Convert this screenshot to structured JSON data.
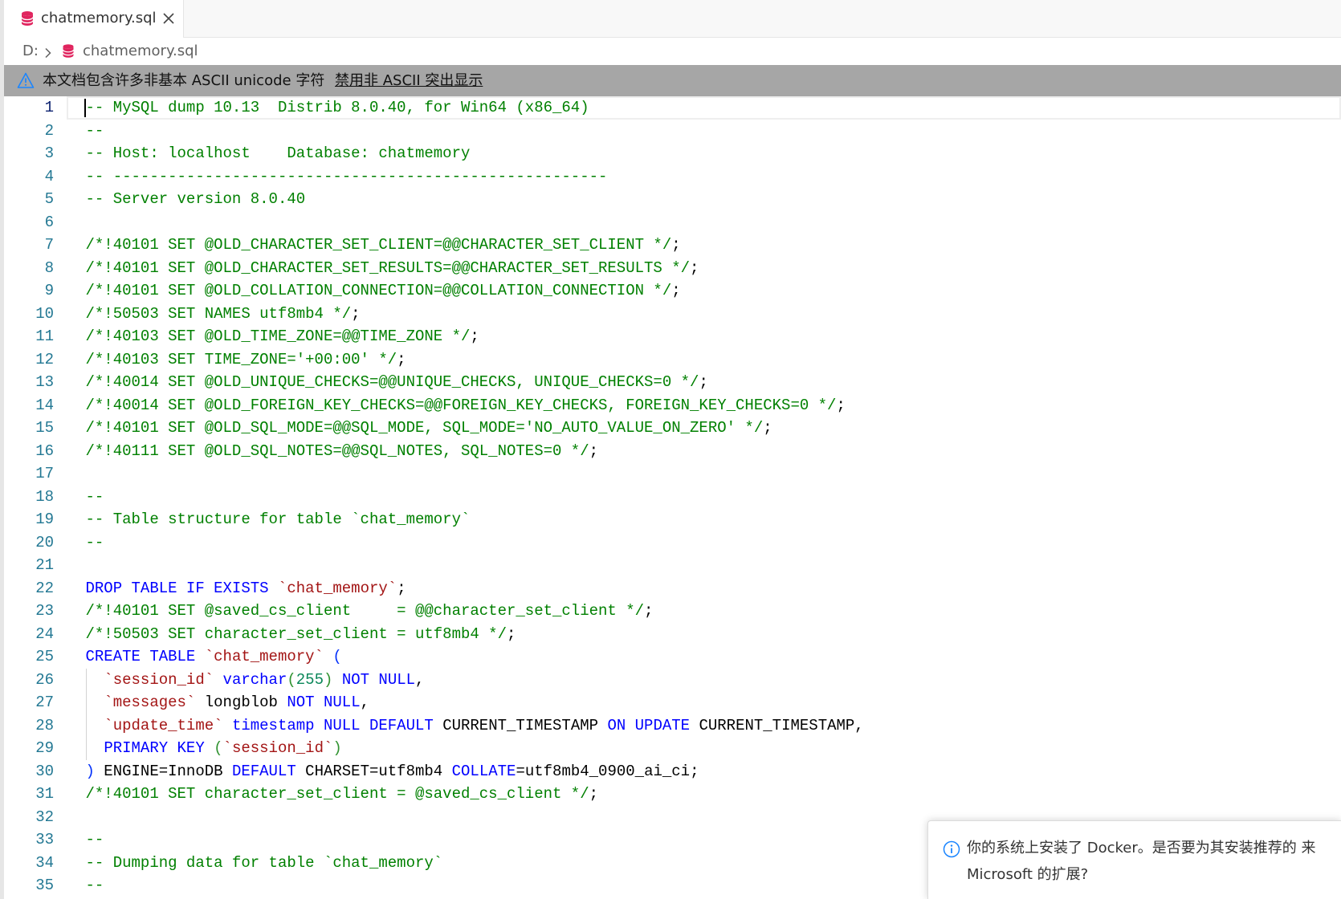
{
  "tab": {
    "title": "chatmemory.sql",
    "icon": "database-icon",
    "close_icon": "close-icon"
  },
  "breadcrumb": {
    "drive": "D:",
    "separator_icon": "chevron-right-icon",
    "file_icon": "database-icon",
    "file": "chatmemory.sql"
  },
  "banner": {
    "icon": "warning-icon",
    "message": "本文档包含许多非基本 ASCII unicode 字符",
    "action": "禁用非 ASCII 突出显示"
  },
  "editor": {
    "active_line": 1,
    "lines": [
      {
        "n": 1,
        "tokens": [
          {
            "t": "c",
            "v": "-- MySQL dump 10.13  Distrib 8.0.40, for Win64 (x86_64)"
          }
        ]
      },
      {
        "n": 2,
        "tokens": [
          {
            "t": "c",
            "v": "--"
          }
        ]
      },
      {
        "n": 3,
        "tokens": [
          {
            "t": "c",
            "v": "-- Host: localhost    Database: chatmemory"
          }
        ]
      },
      {
        "n": 4,
        "tokens": [
          {
            "t": "c",
            "v": "-- ------------------------------------------------------"
          }
        ]
      },
      {
        "n": 5,
        "tokens": [
          {
            "t": "c",
            "v": "-- Server version 8.0.40"
          }
        ]
      },
      {
        "n": 6,
        "tokens": []
      },
      {
        "n": 7,
        "tokens": [
          {
            "t": "c",
            "v": "/*!40101 SET @OLD_CHARACTER_SET_CLIENT=@@CHARACTER_SET_CLIENT */"
          },
          {
            "t": "p",
            "v": ";"
          }
        ]
      },
      {
        "n": 8,
        "tokens": [
          {
            "t": "c",
            "v": "/*!40101 SET @OLD_CHARACTER_SET_RESULTS=@@CHARACTER_SET_RESULTS */"
          },
          {
            "t": "p",
            "v": ";"
          }
        ]
      },
      {
        "n": 9,
        "tokens": [
          {
            "t": "c",
            "v": "/*!40101 SET @OLD_COLLATION_CONNECTION=@@COLLATION_CONNECTION */"
          },
          {
            "t": "p",
            "v": ";"
          }
        ]
      },
      {
        "n": 10,
        "tokens": [
          {
            "t": "c",
            "v": "/*!50503 SET NAMES utf8mb4 */"
          },
          {
            "t": "p",
            "v": ";"
          }
        ]
      },
      {
        "n": 11,
        "tokens": [
          {
            "t": "c",
            "v": "/*!40103 SET @OLD_TIME_ZONE=@@TIME_ZONE */"
          },
          {
            "t": "p",
            "v": ";"
          }
        ]
      },
      {
        "n": 12,
        "tokens": [
          {
            "t": "c",
            "v": "/*!40103 SET TIME_ZONE='+00:00' */"
          },
          {
            "t": "p",
            "v": ";"
          }
        ]
      },
      {
        "n": 13,
        "tokens": [
          {
            "t": "c",
            "v": "/*!40014 SET @OLD_UNIQUE_CHECKS=@@UNIQUE_CHECKS, UNIQUE_CHECKS=0 */"
          },
          {
            "t": "p",
            "v": ";"
          }
        ]
      },
      {
        "n": 14,
        "tokens": [
          {
            "t": "c",
            "v": "/*!40014 SET @OLD_FOREIGN_KEY_CHECKS=@@FOREIGN_KEY_CHECKS, FOREIGN_KEY_CHECKS=0 */"
          },
          {
            "t": "p",
            "v": ";"
          }
        ]
      },
      {
        "n": 15,
        "tokens": [
          {
            "t": "c",
            "v": "/*!40101 SET @OLD_SQL_MODE=@@SQL_MODE, SQL_MODE='NO_AUTO_VALUE_ON_ZERO' */"
          },
          {
            "t": "p",
            "v": ";"
          }
        ]
      },
      {
        "n": 16,
        "tokens": [
          {
            "t": "c",
            "v": "/*!40111 SET @OLD_SQL_NOTES=@@SQL_NOTES, SQL_NOTES=0 */"
          },
          {
            "t": "p",
            "v": ";"
          }
        ]
      },
      {
        "n": 17,
        "tokens": []
      },
      {
        "n": 18,
        "tokens": [
          {
            "t": "c",
            "v": "--"
          }
        ]
      },
      {
        "n": 19,
        "tokens": [
          {
            "t": "c",
            "v": "-- Table structure for table `chat_memory`"
          }
        ]
      },
      {
        "n": 20,
        "tokens": [
          {
            "t": "c",
            "v": "--"
          }
        ]
      },
      {
        "n": 21,
        "tokens": []
      },
      {
        "n": 22,
        "tokens": [
          {
            "t": "k",
            "v": "DROP TABLE IF EXISTS"
          },
          {
            "t": "p",
            "v": " "
          },
          {
            "t": "s",
            "v": "`chat_memory`"
          },
          {
            "t": "p",
            "v": ";"
          }
        ]
      },
      {
        "n": 23,
        "tokens": [
          {
            "t": "c",
            "v": "/*!40101 SET @saved_cs_client     = @@character_set_client */"
          },
          {
            "t": "p",
            "v": ";"
          }
        ]
      },
      {
        "n": 24,
        "tokens": [
          {
            "t": "c",
            "v": "/*!50503 SET character_set_client = utf8mb4 */"
          },
          {
            "t": "p",
            "v": ";"
          }
        ]
      },
      {
        "n": 25,
        "tokens": [
          {
            "t": "k",
            "v": "CREATE TABLE"
          },
          {
            "t": "p",
            "v": " "
          },
          {
            "t": "s",
            "v": "`chat_memory`"
          },
          {
            "t": "p",
            "v": " "
          },
          {
            "t": "b",
            "v": "("
          }
        ]
      },
      {
        "n": 26,
        "tokens": [
          {
            "t": "p",
            "v": "  "
          },
          {
            "t": "s",
            "v": "`session_id`"
          },
          {
            "t": "p",
            "v": " "
          },
          {
            "t": "k",
            "v": "varchar"
          },
          {
            "t": "b2",
            "v": "("
          },
          {
            "t": "n",
            "v": "255"
          },
          {
            "t": "b2",
            "v": ")"
          },
          {
            "t": "p",
            "v": " "
          },
          {
            "t": "k",
            "v": "NOT NULL"
          },
          {
            "t": "p",
            "v": ","
          }
        ]
      },
      {
        "n": 27,
        "tokens": [
          {
            "t": "p",
            "v": "  "
          },
          {
            "t": "s",
            "v": "`messages`"
          },
          {
            "t": "p",
            "v": " longblob "
          },
          {
            "t": "k",
            "v": "NOT NULL"
          },
          {
            "t": "p",
            "v": ","
          }
        ]
      },
      {
        "n": 28,
        "tokens": [
          {
            "t": "p",
            "v": "  "
          },
          {
            "t": "s",
            "v": "`update_time`"
          },
          {
            "t": "p",
            "v": " "
          },
          {
            "t": "k",
            "v": "timestamp NULL DEFAULT"
          },
          {
            "t": "p",
            "v": " CURRENT_TIMESTAMP "
          },
          {
            "t": "k",
            "v": "ON UPDATE"
          },
          {
            "t": "p",
            "v": " CURRENT_TIMESTAMP,"
          }
        ]
      },
      {
        "n": 29,
        "tokens": [
          {
            "t": "p",
            "v": "  "
          },
          {
            "t": "k",
            "v": "PRIMARY KEY"
          },
          {
            "t": "p",
            "v": " "
          },
          {
            "t": "b2",
            "v": "("
          },
          {
            "t": "s",
            "v": "`session_id`"
          },
          {
            "t": "b2",
            "v": ")"
          }
        ]
      },
      {
        "n": 30,
        "tokens": [
          {
            "t": "b",
            "v": ")"
          },
          {
            "t": "p",
            "v": " ENGINE=InnoDB "
          },
          {
            "t": "k",
            "v": "DEFAULT"
          },
          {
            "t": "p",
            "v": " CHARSET=utf8mb4 "
          },
          {
            "t": "k",
            "v": "COLLATE"
          },
          {
            "t": "p",
            "v": "=utf8mb4_0900_ai_ci;"
          }
        ]
      },
      {
        "n": 31,
        "tokens": [
          {
            "t": "c",
            "v": "/*!40101 SET character_set_client = @saved_cs_client */"
          },
          {
            "t": "p",
            "v": ";"
          }
        ]
      },
      {
        "n": 32,
        "tokens": []
      },
      {
        "n": 33,
        "tokens": [
          {
            "t": "c",
            "v": "--"
          }
        ]
      },
      {
        "n": 34,
        "tokens": [
          {
            "t": "c",
            "v": "-- Dumping data for table `chat_memory`"
          }
        ]
      },
      {
        "n": 35,
        "tokens": [
          {
            "t": "c",
            "v": "--"
          }
        ]
      }
    ]
  },
  "notification": {
    "icon": "info-icon",
    "line1": "你的系统上安装了 Docker。是否要为其安装推荐的 来",
    "line2": "Microsoft 的扩展?"
  },
  "colors": {
    "comment": "#008000",
    "keyword": "#0000ff",
    "string": "#a31515",
    "plain": "#000000",
    "number": "#098658",
    "bracket": "#0431fa",
    "bracket_nested": "#319331",
    "line_number": "#237893",
    "active_line_number": "#0b216f",
    "file_icon": "#e0245e",
    "accent": "#1a85ff",
    "banner_bg": "#a6a6a6"
  }
}
